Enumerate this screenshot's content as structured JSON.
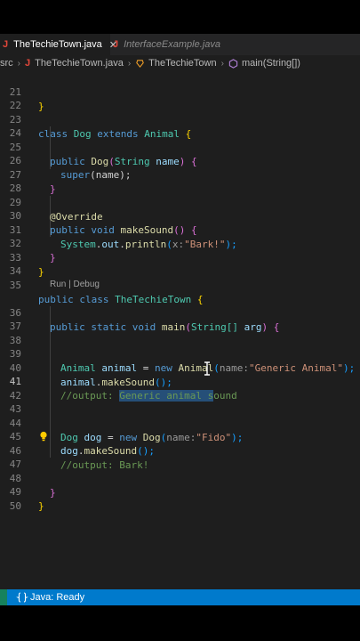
{
  "tabs": [
    {
      "icon": "J",
      "label": "TheTechieTown.java",
      "close": "✕"
    },
    {
      "icon": "J",
      "label": "InterfaceExample.java"
    }
  ],
  "breadcrumb": {
    "folder": "src",
    "file_icon": "J",
    "file": "TheTechieTown.java",
    "class": "TheTechieTown",
    "method": "main(String[])"
  },
  "editor": {
    "line_numbers": [
      "21",
      "22",
      "23",
      "24",
      "25",
      "26",
      "27",
      "28",
      "29",
      "30",
      "31",
      "32",
      "33",
      "34",
      "35",
      "36",
      "37",
      "38",
      "39",
      "40",
      "41",
      "42",
      "43",
      "44",
      "45",
      "46",
      "47",
      "48",
      "49",
      "50"
    ],
    "codelens": "Run | Debug",
    "code": {
      "l21": "}",
      "l23_kw1": "class",
      "l23_name": "Dog",
      "l23_kw2": "extends",
      "l23_parent": "Animal",
      "l23_brace": "{",
      "l25_kw": "public",
      "l25_name": "Dog",
      "l25_open": "(",
      "l25_type": "String",
      "l25_param": "name",
      "l25_close": ")",
      "l25_brace": "{",
      "l26_call": "super",
      "l26_args": "(name);",
      "l27": "}",
      "l29": "@Override",
      "l30_kw1": "public",
      "l30_kw2": "void",
      "l30_name": "makeSound",
      "l30_parens": "()",
      "l30_brace": "{",
      "l31_class": "System",
      "l31_dot1": ".",
      "l31_field": "out",
      "l31_dot2": ".",
      "l31_method": "println",
      "l31_open": "(",
      "l31_hint": "x:",
      "l31_str": "\"Bark!\"",
      "l31_close": ");",
      "l32": "}",
      "l33": "}",
      "l35_kw1": "public",
      "l35_kw2": "class",
      "l35_name": "TheTechieTown",
      "l35_brace": "{",
      "l36_kw1": "public",
      "l36_kw2": "static",
      "l36_kw3": "void",
      "l36_name": "main",
      "l36_open": "(",
      "l36_type": "String[]",
      "l36_param": "arg",
      "l36_close": ")",
      "l36_brace": "{",
      "l39_type": "Animal",
      "l39_var": "animal",
      "l39_eq": " = ",
      "l39_new": "new",
      "l39_ctor": "Animal",
      "l39_open": "(",
      "l39_hint": "name:",
      "l39_str": "\"Generic Animal\"",
      "l39_close": ");",
      "l40_var": "animal",
      "l40_dot": ".",
      "l40_method": "makeSound",
      "l40_rest": "();",
      "l41_pre": "//output: ",
      "l41_sel": "Generic animal s",
      "l41_post": "ound",
      "l44_type": "Dog",
      "l44_var": "dog",
      "l44_eq": " = ",
      "l44_new": "new",
      "l44_ctor": "Dog",
      "l44_open": "(",
      "l44_hint": "name:",
      "l44_str": "\"Fido\"",
      "l44_close": ");",
      "l45_var": "dog",
      "l45_dot": ".",
      "l45_method": "makeSound",
      "l45_rest": "();",
      "l46": "//output: Bark!",
      "l48": "}",
      "l49": "}"
    }
  },
  "status_bar": {
    "language_status": "Java: Ready"
  },
  "colors": {
    "status_bar": "#007acc",
    "editor_bg": "#1e1e1e",
    "keyword": "#569cd6",
    "type": "#4ec9b0",
    "string": "#ce9178",
    "comment": "#6a9955"
  }
}
